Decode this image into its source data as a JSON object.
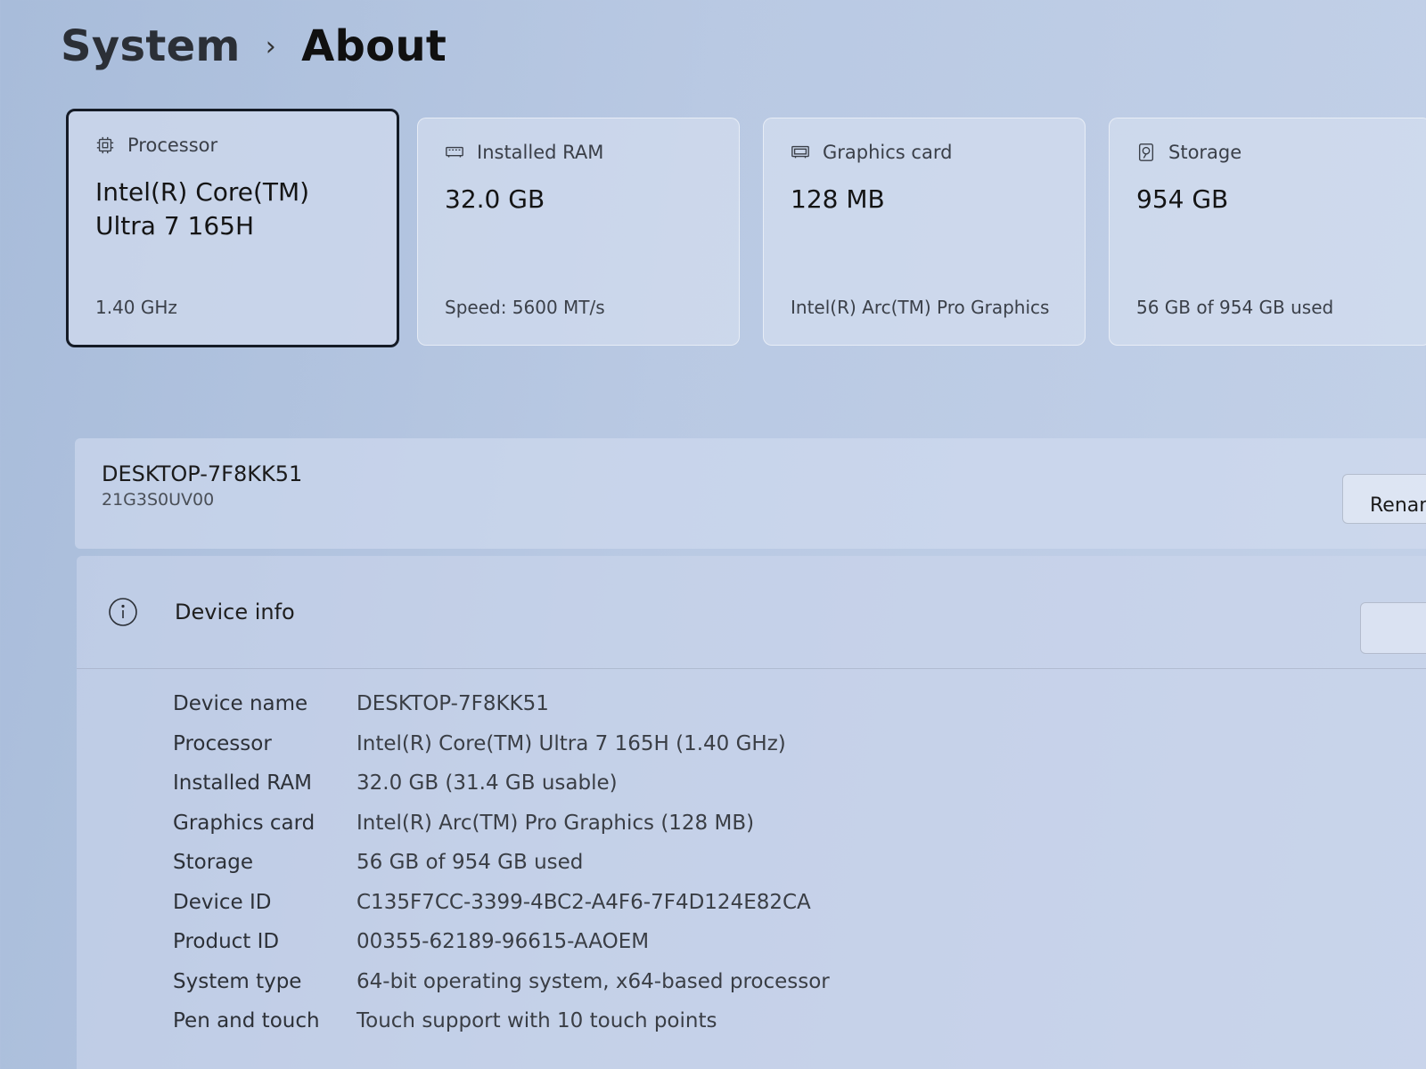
{
  "breadcrumb": {
    "parent": "System",
    "separator": "›",
    "current": "About"
  },
  "cards": [
    {
      "title": "Processor",
      "icon": "processor-icon",
      "value": "Intel(R) Core(TM) Ultra 7 165H",
      "sub": "1.40 GHz"
    },
    {
      "title": "Installed RAM",
      "icon": "ram-icon",
      "value": "32.0 GB",
      "sub": "Speed: 5600 MT/s"
    },
    {
      "title": "Graphics card",
      "icon": "graphics-card-icon",
      "value": "128 MB",
      "sub": "Intel(R) Arc(TM) Pro Graphics"
    },
    {
      "title": "Storage",
      "icon": "storage-icon",
      "value": "954 GB",
      "sub": "56 GB of 954 GB used"
    }
  ],
  "device": {
    "name": "DESKTOP-7F8KK51",
    "model": "21G3S0UV00",
    "rename_label": "Rename this PC"
  },
  "device_info": {
    "title": "Device info",
    "rows": [
      {
        "label": "Device name",
        "value": "DESKTOP-7F8KK51"
      },
      {
        "label": "Processor",
        "value": "Intel(R) Core(TM) Ultra 7 165H (1.40 GHz)"
      },
      {
        "label": "Installed RAM",
        "value": "32.0 GB (31.4 GB usable)"
      },
      {
        "label": "Graphics card",
        "value": "Intel(R) Arc(TM) Pro Graphics (128 MB)"
      },
      {
        "label": "Storage",
        "value": "56 GB of 954 GB used"
      },
      {
        "label": "Device ID",
        "value": "C135F7CC-3399-4BC2-A4F6-7F4D124E82CA"
      },
      {
        "label": "Product ID",
        "value": "00355-62189-96615-AAOEM"
      },
      {
        "label": "System type",
        "value": "64-bit operating system, x64-based processor"
      },
      {
        "label": "Pen and touch",
        "value": "Touch support with 10 touch points"
      }
    ]
  }
}
